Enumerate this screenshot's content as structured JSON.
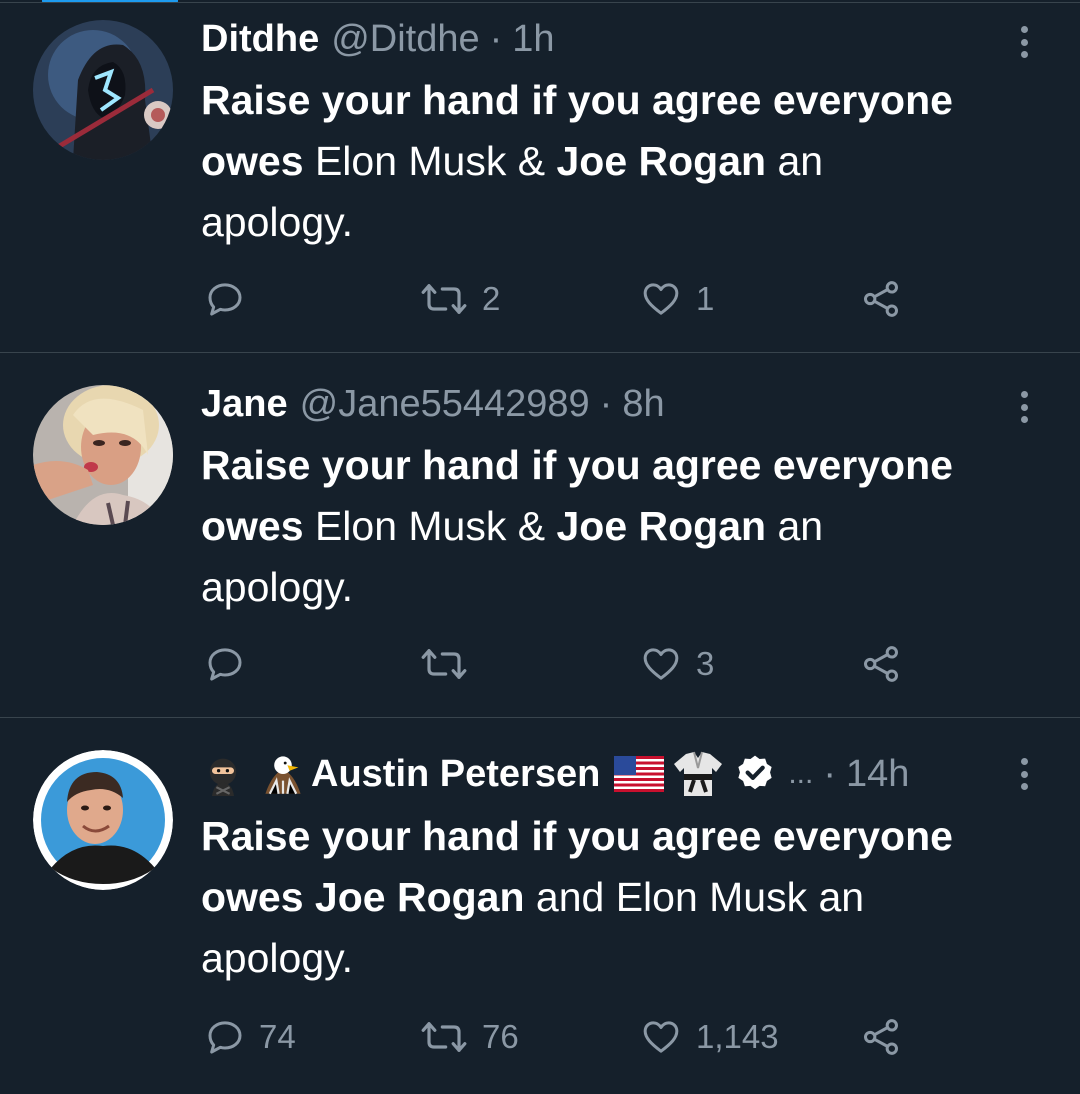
{
  "tweets": [
    {
      "display_name": "Ditdhe",
      "handle": "@Ditdhe",
      "time": "1h",
      "text": {
        "b1": "Raise your hand if you agree everyone",
        "b2": "owes",
        "n1": " Elon Musk & ",
        "b3": "Joe Rogan",
        "n2": " an",
        "n3": "apology."
      },
      "replies": "",
      "retweets": "2",
      "likes": "1"
    },
    {
      "display_name": "Jane",
      "handle": "@Jane55442989",
      "time": "8h",
      "text": {
        "b1": "Raise your hand if you agree everyone",
        "b2": "owes",
        "n1": " Elon Musk & ",
        "b3": "Joe Rogan",
        "n2": " an",
        "n3": "apology."
      },
      "replies": "",
      "retweets": "",
      "likes": "3"
    },
    {
      "display_name": "Austin Petersen",
      "handle_truncated": "...",
      "time": "14h",
      "text": {
        "b1": "Raise your hand if you agree everyone",
        "b2": "owes Joe Rogan",
        "n1": " and Elon Musk an",
        "n3": "apology."
      },
      "replies": "74",
      "retweets": "76",
      "likes": "1,143"
    }
  ],
  "icons": [
    "more-vertical-icon",
    "reply-icon",
    "retweet-icon",
    "like-icon",
    "share-icon",
    "ninja-emoji",
    "eagle-emoji",
    "us-flag-emoji",
    "martial-arts-uniform-emoji",
    "verified-badge-icon"
  ],
  "colors": {
    "background": "#15202b",
    "text": "#ffffff",
    "secondary": "#8b98a5",
    "divider": "#38444d",
    "accent": "#1d9bf0"
  }
}
